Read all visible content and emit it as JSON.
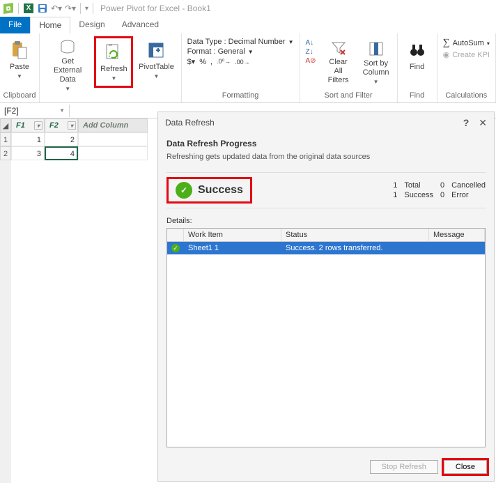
{
  "titlebar": {
    "app_title": "Power Pivot for Excel - Book1"
  },
  "tabs": {
    "file": "File",
    "home": "Home",
    "design": "Design",
    "advanced": "Advanced"
  },
  "ribbon": {
    "clipboard": {
      "paste": "Paste",
      "label": "Clipboard"
    },
    "getdata": {
      "get_external": "Get External\nData",
      "refresh": "Refresh",
      "pivot": "PivotTable",
      "label": ""
    },
    "formatting": {
      "datatype": "Data Type : Decimal Number",
      "format": "Format : General",
      "label": "Formatting"
    },
    "sortfilter": {
      "clear": "Clear All\nFilters",
      "sort": "Sort by\nColumn",
      "label": "Sort and Filter"
    },
    "find": {
      "find": "Find",
      "label": "Find"
    },
    "calc": {
      "autosum": "AutoSum",
      "kpi": "Create KPI",
      "label": "Calculations"
    }
  },
  "namebox": "[F2]",
  "columns": {
    "f1": "F1",
    "f2": "F2",
    "add": "Add Column"
  },
  "cells": {
    "r1c1": "1",
    "r1c2": "2",
    "r2c1": "3",
    "r2c2": "4"
  },
  "dialog": {
    "title": "Data Refresh",
    "heading": "Data Refresh Progress",
    "subtitle": "Refreshing gets updated data from the original data sources",
    "success": "Success",
    "stats": {
      "total_n": "1",
      "total": "Total",
      "cancel_n": "0",
      "cancel": "Cancelled",
      "success_n": "1",
      "success": "Success",
      "error_n": "0",
      "error": "Error"
    },
    "details": "Details:",
    "hdr_work": "Work Item",
    "hdr_status": "Status",
    "hdr_msg": "Message",
    "row_work": "Sheet1 1",
    "row_status": "Success. 2 rows transferred.",
    "row_msg": "",
    "btn_stop": "Stop Refresh",
    "btn_close": "Close"
  }
}
